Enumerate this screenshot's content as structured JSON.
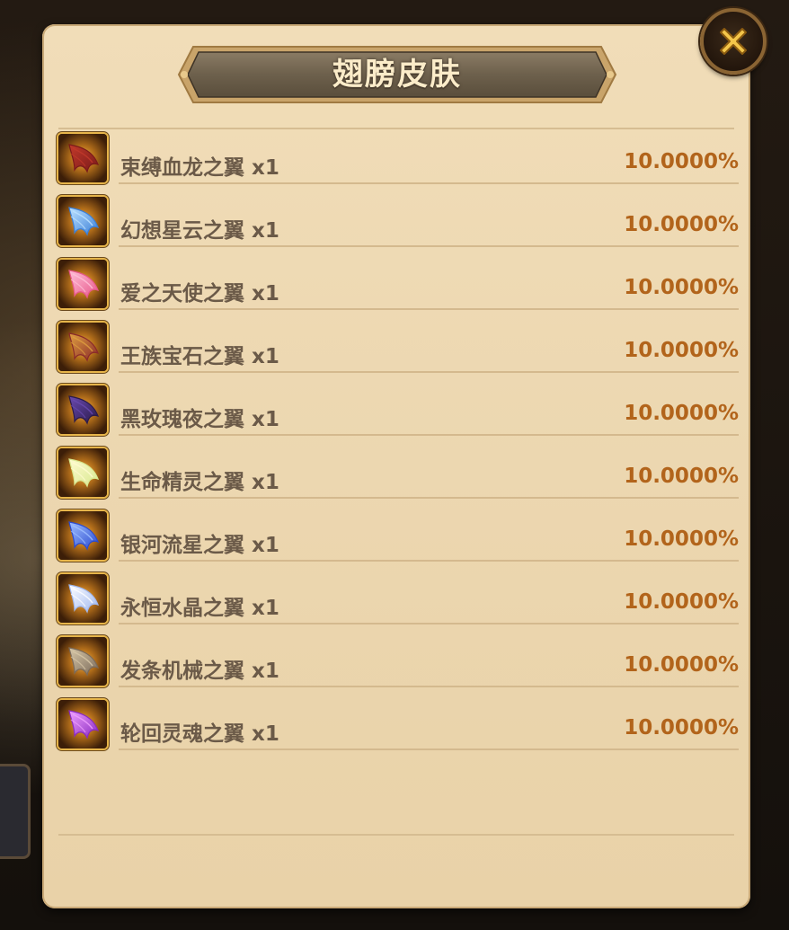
{
  "dialog": {
    "title": "翅膀皮肤",
    "close_icon": "close-icon"
  },
  "items": [
    {
      "name": "束缚血龙之翼 x1",
      "rate": "10.0000%",
      "icon": "dragon-wing-icon",
      "colors": [
        "#7a1a1a",
        "#c23a2a"
      ]
    },
    {
      "name": "幻想星云之翼 x1",
      "rate": "10.0000%",
      "icon": "nebula-wing-icon",
      "colors": [
        "#3a7fd8",
        "#bfe3ff"
      ]
    },
    {
      "name": "爱之天使之翼 x1",
      "rate": "10.0000%",
      "icon": "angel-wing-icon",
      "colors": [
        "#e7578a",
        "#ffc0d8"
      ]
    },
    {
      "name": "王族宝石之翼 x1",
      "rate": "10.0000%",
      "icon": "gem-wing-icon",
      "colors": [
        "#8a2a2a",
        "#e0a040"
      ]
    },
    {
      "name": "黑玫瑰夜之翼 x1",
      "rate": "10.0000%",
      "icon": "black-rose-wing-icon",
      "colors": [
        "#2a1a4a",
        "#6a4ab0"
      ]
    },
    {
      "name": "生命精灵之翼 x1",
      "rate": "10.0000%",
      "icon": "spirit-wing-icon",
      "colors": [
        "#d8e890",
        "#fffbd0"
      ]
    },
    {
      "name": "银河流星之翼 x1",
      "rate": "10.0000%",
      "icon": "galaxy-wing-icon",
      "colors": [
        "#2a4ad0",
        "#a0c0ff"
      ]
    },
    {
      "name": "永恒水晶之翼 x1",
      "rate": "10.0000%",
      "icon": "crystal-wing-icon",
      "colors": [
        "#a0b8f0",
        "#ffffff"
      ]
    },
    {
      "name": "发条机械之翼 x1",
      "rate": "10.0000%",
      "icon": "clockwork-wing-icon",
      "colors": [
        "#7a6a5a",
        "#d8c8a8"
      ]
    },
    {
      "name": "轮回灵魂之翼 x1",
      "rate": "10.0000%",
      "icon": "soul-wing-icon",
      "colors": [
        "#8a2ac0",
        "#f0a0ff"
      ]
    }
  ],
  "theme": {
    "panel_bg": "#ecd7b0",
    "rate_color": "#b2641b",
    "name_color": "#6b5a48",
    "frame_gold": "#e7b54a"
  }
}
